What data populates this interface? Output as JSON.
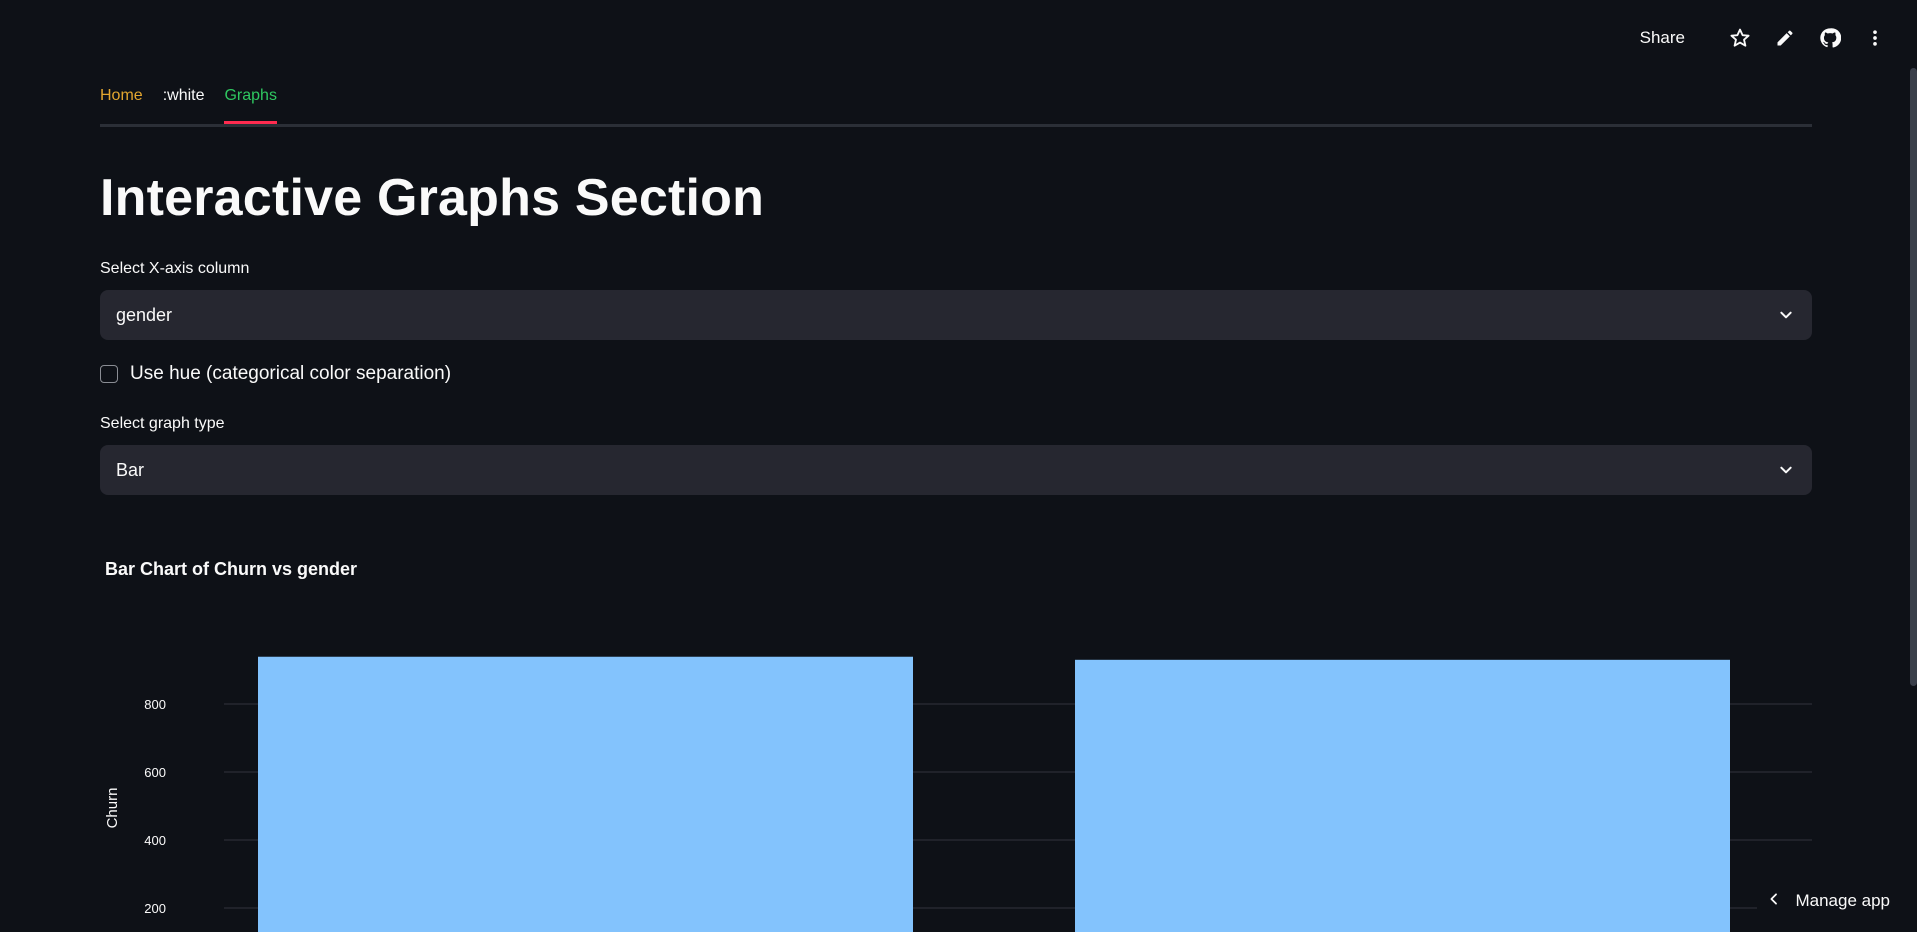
{
  "toolbar": {
    "share_label": "Share",
    "icons": [
      "star-icon",
      "pencil-icon",
      "github-icon",
      "more-vertical-icon"
    ]
  },
  "tabs": [
    {
      "label": "Home",
      "color": "#e3a62f"
    },
    {
      "label": ":white",
      "color": "#fafafa"
    },
    {
      "label": "Graphs",
      "color": "#2fc760",
      "active": true
    }
  ],
  "page": {
    "title": "Interactive Graphs Section"
  },
  "x_select": {
    "label": "Select X-axis column",
    "value": "gender"
  },
  "hue_checkbox": {
    "label": "Use hue (categorical color separation)",
    "checked": false
  },
  "graph_select": {
    "label": "Select graph type",
    "value": "Bar"
  },
  "chart_data": {
    "type": "bar",
    "title": "Bar Chart of Churn vs gender",
    "xlabel": "",
    "ylabel": "Churn",
    "y_ticks": [
      200,
      400,
      600,
      800
    ],
    "categories": [
      "",
      ""
    ],
    "values": [
      939,
      930
    ],
    "bar_color": "#83c3fd",
    "grid": true
  },
  "manage_app": {
    "label": "Manage app"
  },
  "colors": {
    "background": "#0e1117",
    "input_bg": "#262730",
    "accent": "#ff2b4f"
  }
}
